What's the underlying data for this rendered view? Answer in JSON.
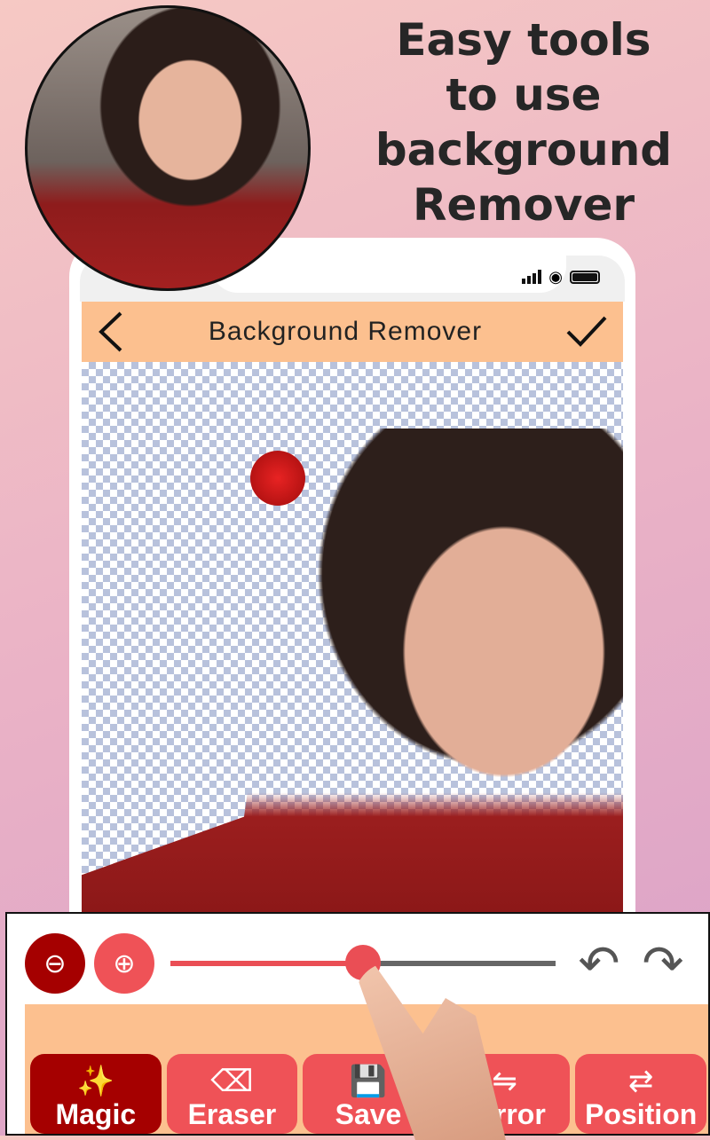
{
  "headline": [
    "Easy tools",
    "to use",
    "background",
    "Remover"
  ],
  "app_bar": {
    "title": "Background Remover",
    "back_icon": "chevron-left-icon",
    "done_icon": "check-icon"
  },
  "status": {
    "icons": [
      "signal-icon",
      "wifi-icon",
      "battery-icon"
    ]
  },
  "toolbar": {
    "magic_minus_icon": "magic-wand-minus-icon",
    "magic_plus_icon": "magic-wand-plus-icon",
    "brush_size_percent": 50,
    "undo": "↶",
    "redo": "↷"
  },
  "tabs": [
    {
      "label": "Magic",
      "icon": "✨",
      "active": true
    },
    {
      "label": "Eraser",
      "icon": "⌫"
    },
    {
      "label": "Save",
      "icon": "💾"
    },
    {
      "label": "Mirror",
      "icon": "⇋"
    },
    {
      "label": "Position",
      "icon": "⇄"
    }
  ],
  "colors": {
    "accent": "#ef5257",
    "active": "#a50000",
    "bar": "#fcc08f"
  }
}
